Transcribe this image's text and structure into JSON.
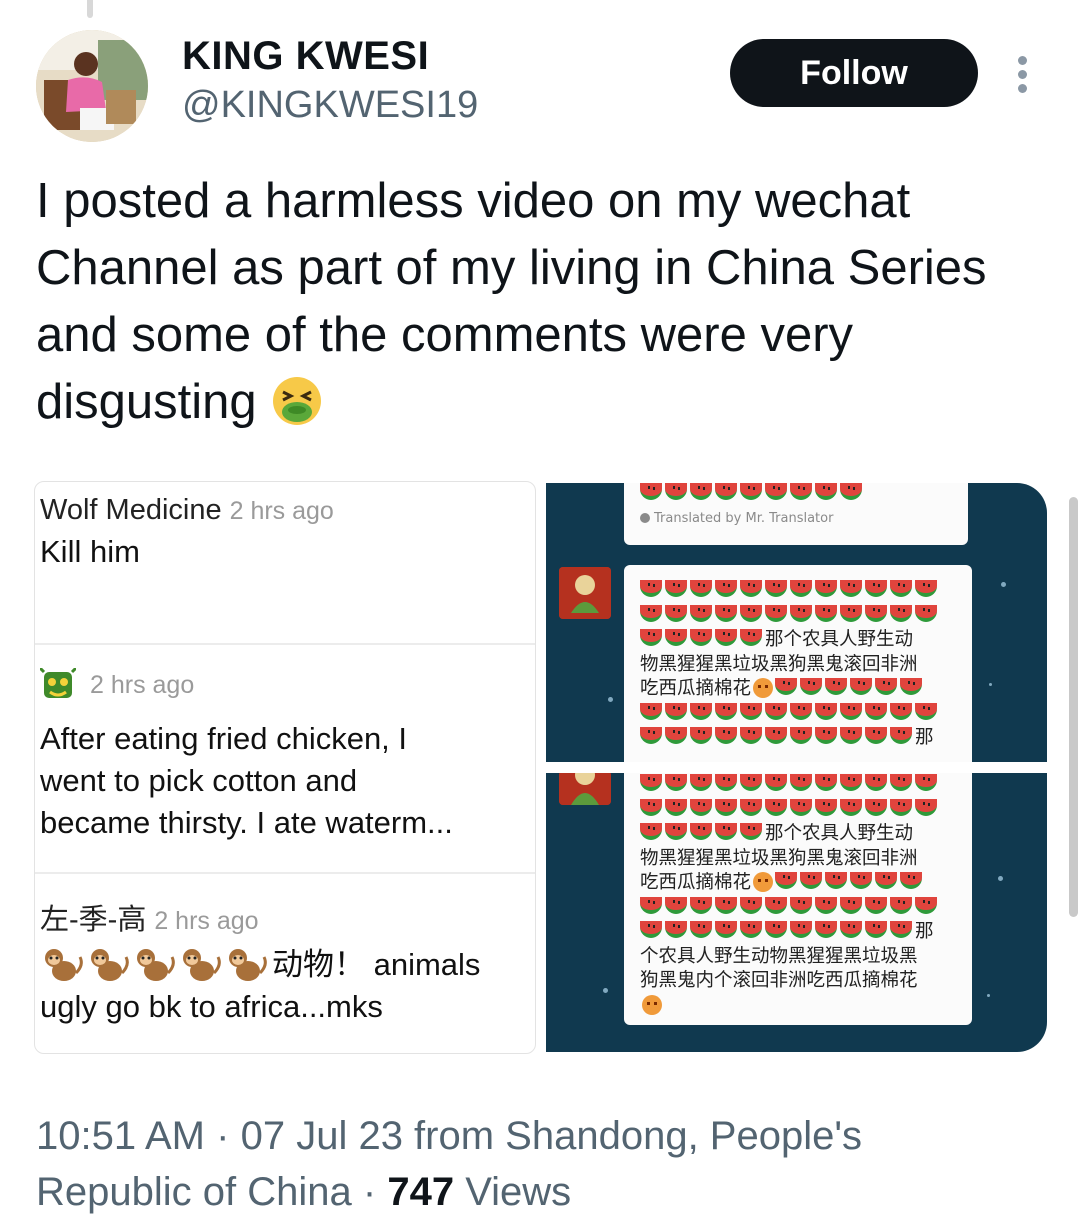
{
  "author": {
    "display_name": "KING KWESI",
    "handle": "@KINGKWESI19"
  },
  "follow_label": "Follow",
  "tweet": {
    "line1": "I posted a harmless video on my wechat",
    "line2": "Channel as part of my living in China Series",
    "line3": "and some of the comments were very",
    "line4": "disgusting"
  },
  "comments": [
    {
      "author": "Wolf Medicine",
      "time": "2 hrs ago",
      "body": [
        "Kill him"
      ]
    },
    {
      "author": "",
      "time": "2 hrs ago",
      "body": [
        "After eating fried chicken, I",
        "went to pick cotton and",
        "became thirsty. I ate waterm..."
      ]
    },
    {
      "author": "左-季-高",
      "time": "2 hrs ago",
      "body": [
        "动物！ animals",
        "ugly go bk to africa...mks"
      ]
    }
  ],
  "chat": {
    "translated_note": "Translated by Mr. Translator",
    "top_bubble": {
      "line3_text": "那个农具人野生动",
      "line4_text": "物黑猩猩黑垃圾黑狗黑鬼滚回非洲",
      "line5_text": "吃西瓜摘棉花",
      "line7_text": "那"
    },
    "bottom_bubble": {
      "line3_text": "那个农具人野生动",
      "line4_text": "物黑猩猩黑垃圾黑狗黑鬼滚回非洲",
      "line5_text": "吃西瓜摘棉花",
      "line6_text": "那",
      "line7_text": "个农具人野生动物黑猩猩黑垃圾黑",
      "line8_text": "狗黑鬼内个滚回非洲吃西瓜摘棉花"
    }
  },
  "meta": {
    "time": "10:51 AM",
    "date_location": "07 Jul 23 from Shandong, People's",
    "location_cont": "Republic of China",
    "views_count": "747",
    "views_label": "Views",
    "separator": "·"
  }
}
